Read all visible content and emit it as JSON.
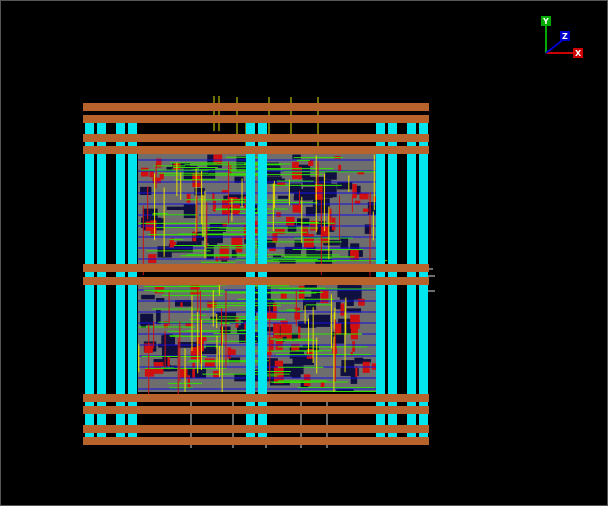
{
  "viewer": {
    "background_color": "#000000",
    "content": "chip-layout"
  },
  "axes": {
    "x_label": "X",
    "y_label": "Y",
    "z_label": "Z",
    "x_color": "#cc0000",
    "y_color": "#00aa00",
    "z_color": "#0000cc"
  },
  "palette": {
    "power_strap": "#b8622c",
    "power_rail": "#00e5ee",
    "std_cell": "#6e6e6e",
    "metal_red": "#d01010",
    "metal_green": "#30e000",
    "metal_yellow": "#e8e000",
    "metal_blue": "#1010e0",
    "dark_navy": "#101040",
    "white_wire": "#dddddd"
  }
}
